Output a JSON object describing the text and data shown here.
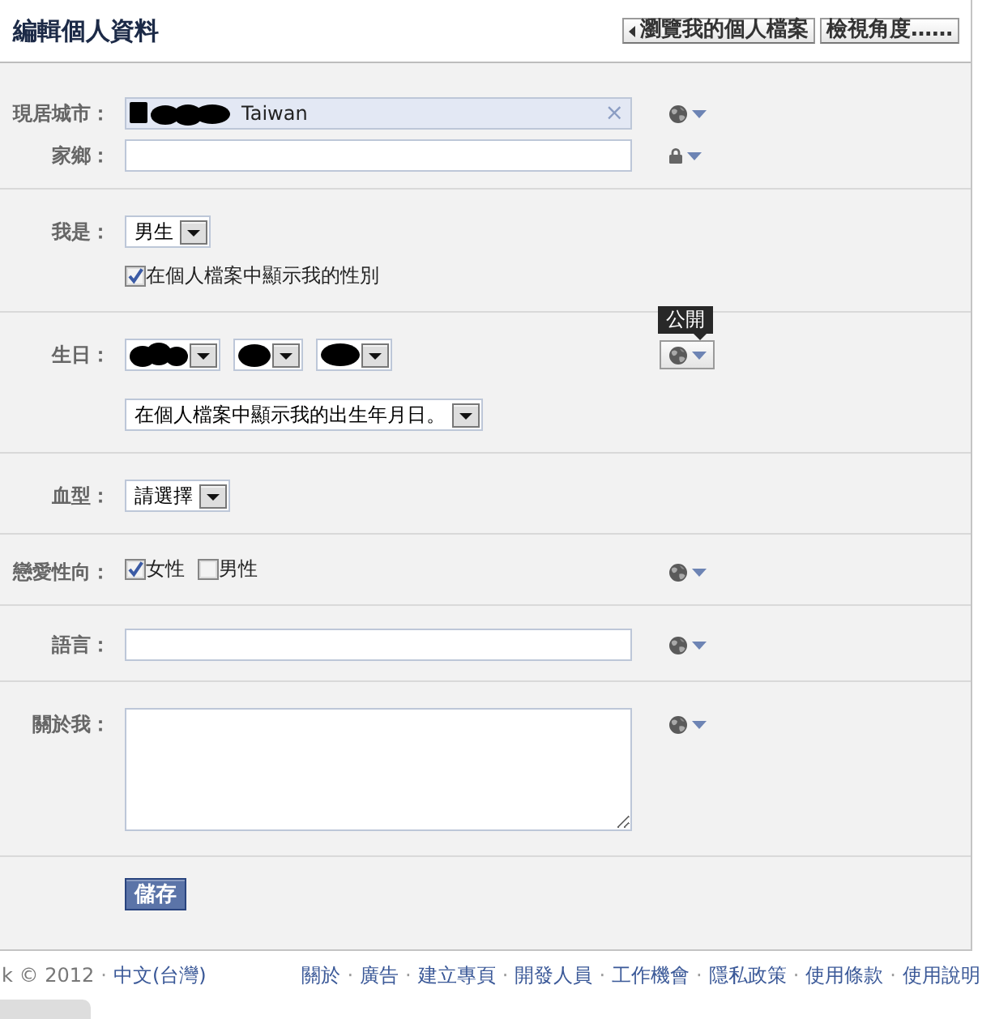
{
  "header": {
    "title": "編輯個人資料",
    "buttons": [
      {
        "kind": "back",
        "label": "瀏覽我的個人檔案"
      },
      {
        "kind": "plain",
        "label": "檢視角度……"
      }
    ]
  },
  "sections": [
    {
      "rows": [
        {
          "label": "現居城市：",
          "field": {
            "kind": "token",
            "redacted": true,
            "value": "Taiwan",
            "clear": "×"
          },
          "privacy": {
            "kind": "globe",
            "hovered": false
          }
        },
        {
          "label": "家鄉：",
          "field": {
            "kind": "text"
          },
          "privacy": {
            "kind": "lock",
            "hovered": false
          }
        }
      ]
    },
    {
      "rows": [
        {
          "label": "我是：",
          "field": {
            "kind": "select",
            "value": "男生"
          }
        },
        {
          "field": {
            "kind": "checkboxes",
            "options": [
              {
                "label": "在個人檔案中顯示我的性別",
                "checked": true
              }
            ]
          }
        }
      ]
    },
    {
      "rows": [
        {
          "label": "生日：",
          "field": {
            "kind": "selects",
            "selects": [
              {
                "redacted": true
              },
              {
                "redacted": true
              },
              {
                "redacted": true
              }
            ]
          },
          "privacy": {
            "kind": "globe",
            "hovered": true,
            "tooltip": "公開"
          }
        },
        {
          "field": {
            "kind": "select",
            "value": "在個人檔案中顯示我的出生年月日。"
          }
        }
      ]
    },
    {
      "rows": [
        {
          "label": "血型：",
          "field": {
            "kind": "select",
            "value": "請選擇"
          }
        }
      ]
    },
    {
      "rows": [
        {
          "label": "戀愛性向：",
          "field": {
            "kind": "checkboxes",
            "options": [
              {
                "label": "女性",
                "checked": true
              },
              {
                "label": "男性",
                "checked": false
              }
            ]
          },
          "privacy": {
            "kind": "globe",
            "hovered": false
          }
        }
      ]
    },
    {
      "rows": [
        {
          "label": "語言：",
          "field": {
            "kind": "text"
          },
          "privacy": {
            "kind": "globe",
            "hovered": false
          }
        }
      ]
    },
    {
      "rows": [
        {
          "label": "關於我：",
          "field": {
            "kind": "textarea"
          },
          "privacy": {
            "kind": "globe",
            "hovered": false
          }
        }
      ]
    },
    {
      "rows": [
        {
          "field": {
            "kind": "button",
            "label": "儲存"
          }
        }
      ]
    }
  ],
  "footer": {
    "left": [
      {
        "kind": "text",
        "text": "k © 2012"
      },
      {
        "kind": "dot",
        "text": "·"
      },
      {
        "kind": "link",
        "text": "中文(台灣)"
      }
    ],
    "right": [
      {
        "kind": "link",
        "text": "關於"
      },
      {
        "kind": "dot",
        "text": "·"
      },
      {
        "kind": "link",
        "text": "廣告"
      },
      {
        "kind": "dot",
        "text": "·"
      },
      {
        "kind": "link",
        "text": "建立專頁"
      },
      {
        "kind": "dot",
        "text": "·"
      },
      {
        "kind": "link",
        "text": "開發人員"
      },
      {
        "kind": "dot",
        "text": "·"
      },
      {
        "kind": "link",
        "text": "工作機會"
      },
      {
        "kind": "dot",
        "text": "·"
      },
      {
        "kind": "link",
        "text": "隱私政策"
      },
      {
        "kind": "dot",
        "text": "·"
      },
      {
        "kind": "link",
        "text": "使用條款"
      },
      {
        "kind": "dot",
        "text": "·"
      },
      {
        "kind": "link",
        "text": "使用說明"
      }
    ]
  }
}
